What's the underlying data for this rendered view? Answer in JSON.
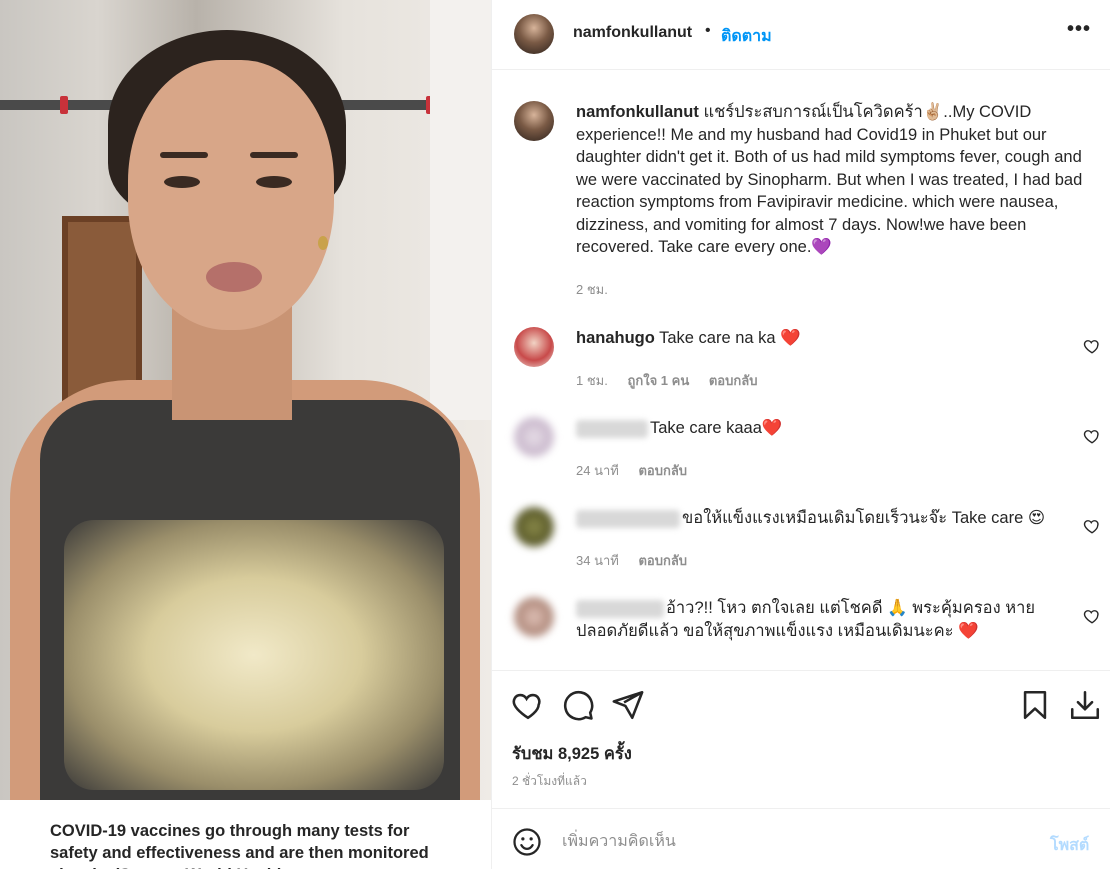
{
  "post": {
    "author": "namfonkullanut",
    "follow_label": "ติดตาม",
    "separator": "•",
    "more_label": "•••",
    "caption": "แชร์ประสบการณ์เป็นโควิดคร้า✌🏼..My COVID experience!! Me and my husband had Covid19 in Phuket but our daughter didn't get it. Both of us had mild symptoms fever, cough and we were vaccinated by Sinopharm. But when I was treated, I had bad reaction symptoms from Favipiravir medicine. which were nausea, dizziness, and vomiting for almost 7 days. Now!we have been recovered. Take care every one.💜",
    "caption_time": "2 ชม.",
    "likes_label": "รับชม 8,925 ครั้ง",
    "timestamp": "2 ชั่วโมงที่แล้ว"
  },
  "media": {
    "info_banner": "COVID-19 vaccines go through many tests for safety and effectiveness and are then monitored closely. (Source: World Health"
  },
  "comments": [
    {
      "username": "hanahugo",
      "text": "Take care na ka ❤️",
      "time": "1 ชม.",
      "likes": "ถูกใจ 1 คน",
      "reply": "ตอบกลับ"
    },
    {
      "username": "",
      "text": "Take care kaaa❤️",
      "time": "24 นาที",
      "likes": "",
      "reply": "ตอบกลับ"
    },
    {
      "username": "",
      "text": "ขอให้แข็งแรงเหมือนเดิมโดยเร็วนะจ๊ะ Take care 😍",
      "time": "34 นาที",
      "likes": "",
      "reply": "ตอบกลับ"
    },
    {
      "username": "",
      "text": "อ้าว?!! โหว ตกใจเลย แต่โชคดี 🙏 พระคุ้มครอง หายปลอดภัยดีแล้ว ขอให้สุขภาพแข็งแรง เหมือนเดิมนะคะ ❤️",
      "time": "",
      "likes": "",
      "reply": ""
    }
  ],
  "comment_box": {
    "placeholder": "เพิ่มความคิดเห็น",
    "post_label": "โพสต์"
  },
  "icons": {
    "like": "heart-icon",
    "comment": "comment-icon",
    "share": "paper-plane-icon",
    "save": "bookmark-icon",
    "download": "download-icon",
    "emoji": "smiley-icon",
    "more": "ellipsis-icon"
  },
  "colors": {
    "accent": "#0095f6",
    "post_disabled": "#b3dbff",
    "muted": "#8e8e8e",
    "text": "#262626"
  }
}
